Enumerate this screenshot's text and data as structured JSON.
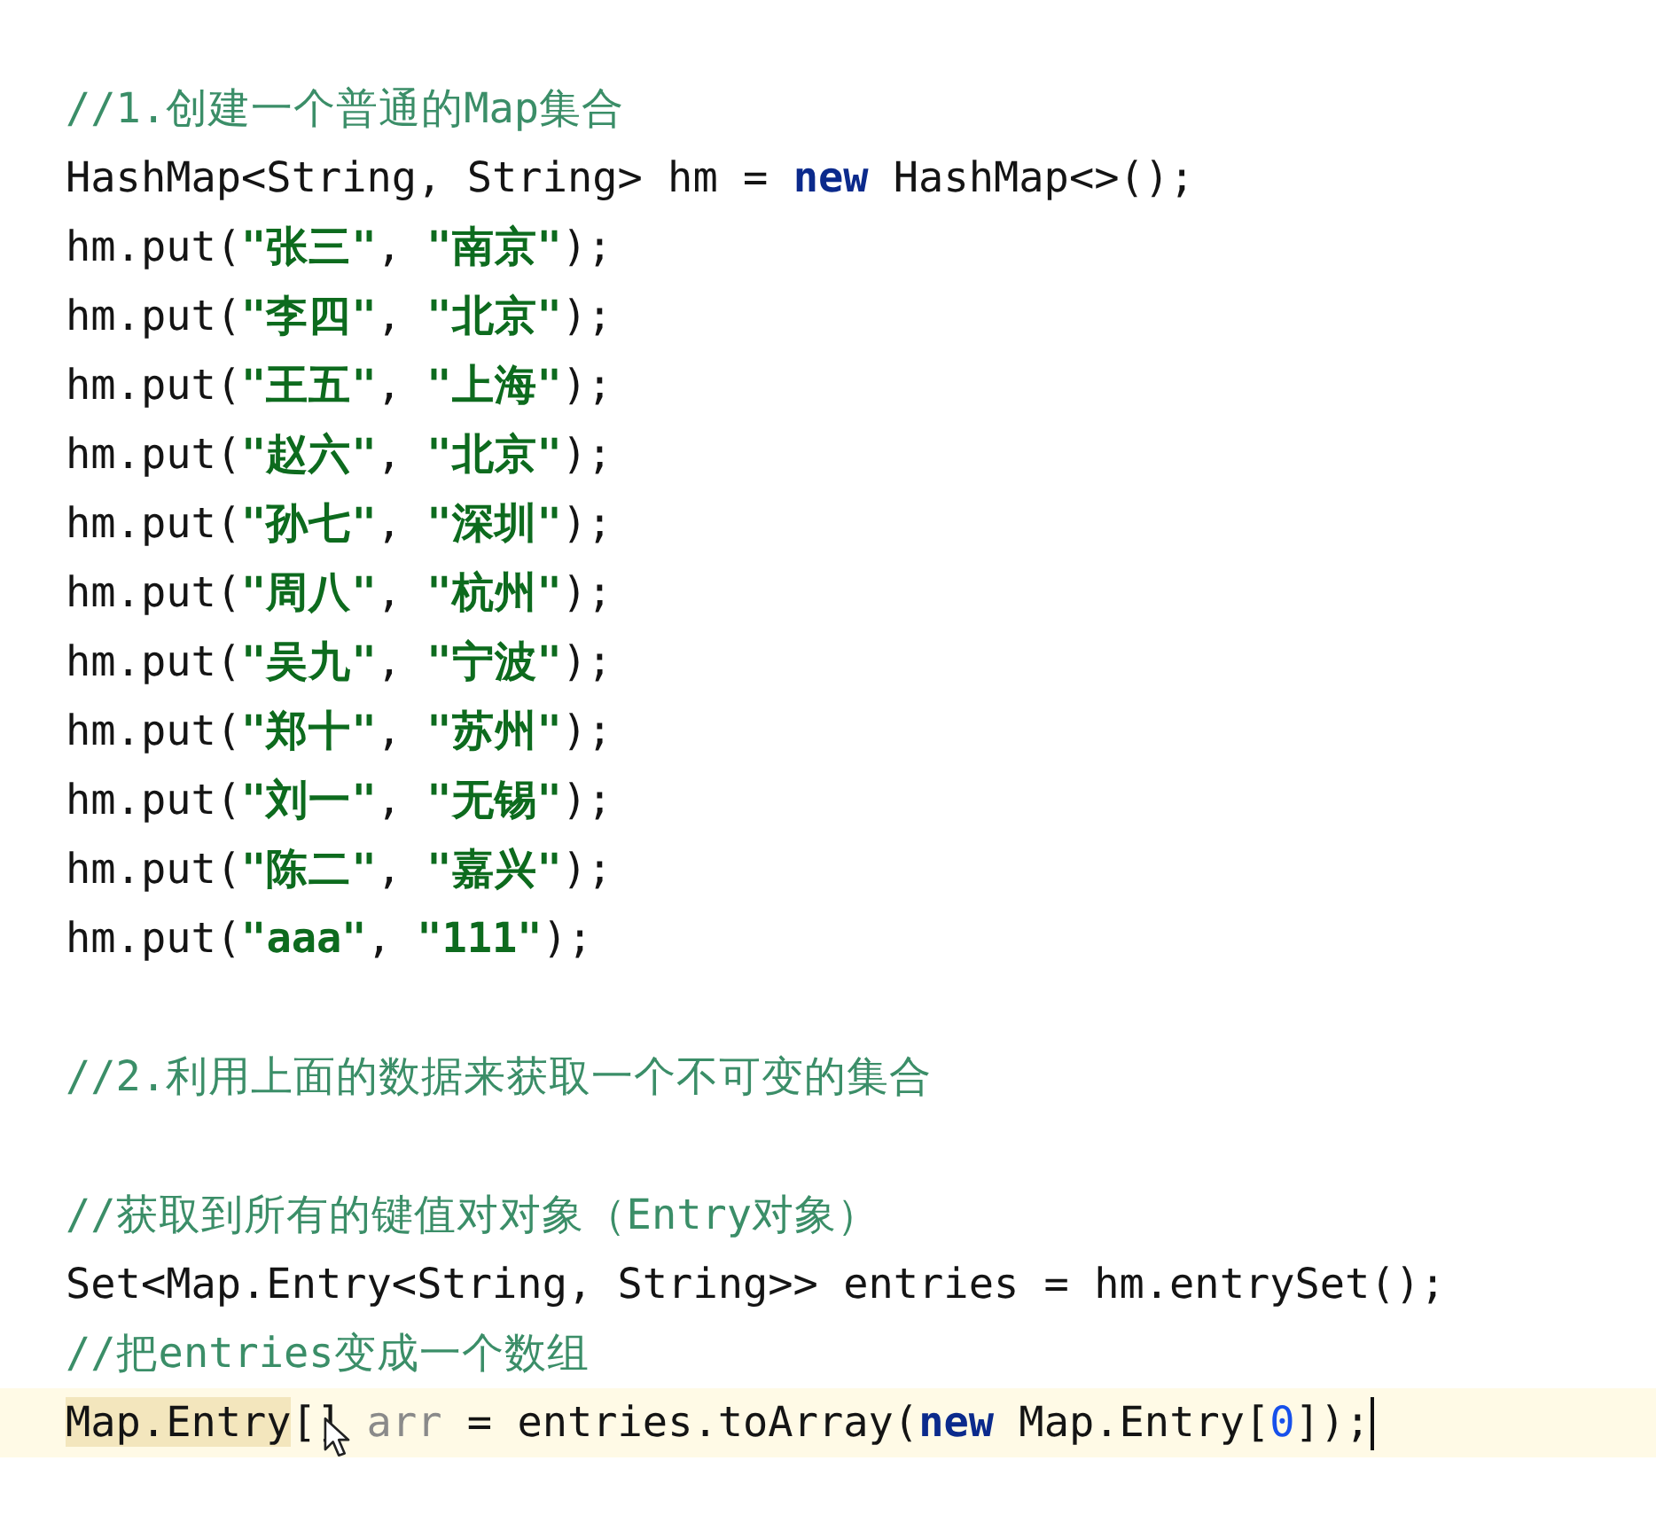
{
  "editor": {
    "lines": [
      {
        "current": false,
        "tokens": [
          {
            "kind": "comment",
            "text": "//1.创建一个普通的Map集合"
          }
        ]
      },
      {
        "current": false,
        "tokens": [
          {
            "kind": "plain",
            "text": "HashMap<String, String> hm = "
          },
          {
            "kind": "keyword",
            "text": "new"
          },
          {
            "kind": "plain",
            "text": " HashMap<>();"
          }
        ]
      },
      {
        "current": false,
        "tokens": [
          {
            "kind": "plain",
            "text": "hm.put("
          },
          {
            "kind": "string",
            "text": "\"张三\""
          },
          {
            "kind": "plain",
            "text": ", "
          },
          {
            "kind": "string",
            "text": "\"南京\""
          },
          {
            "kind": "plain",
            "text": ");"
          }
        ]
      },
      {
        "current": false,
        "tokens": [
          {
            "kind": "plain",
            "text": "hm.put("
          },
          {
            "kind": "string",
            "text": "\"李四\""
          },
          {
            "kind": "plain",
            "text": ", "
          },
          {
            "kind": "string",
            "text": "\"北京\""
          },
          {
            "kind": "plain",
            "text": ");"
          }
        ]
      },
      {
        "current": false,
        "tokens": [
          {
            "kind": "plain",
            "text": "hm.put("
          },
          {
            "kind": "string",
            "text": "\"王五\""
          },
          {
            "kind": "plain",
            "text": ", "
          },
          {
            "kind": "string",
            "text": "\"上海\""
          },
          {
            "kind": "plain",
            "text": ");"
          }
        ]
      },
      {
        "current": false,
        "tokens": [
          {
            "kind": "plain",
            "text": "hm.put("
          },
          {
            "kind": "string",
            "text": "\"赵六\""
          },
          {
            "kind": "plain",
            "text": ", "
          },
          {
            "kind": "string",
            "text": "\"北京\""
          },
          {
            "kind": "plain",
            "text": ");"
          }
        ]
      },
      {
        "current": false,
        "tokens": [
          {
            "kind": "plain",
            "text": "hm.put("
          },
          {
            "kind": "string",
            "text": "\"孙七\""
          },
          {
            "kind": "plain",
            "text": ", "
          },
          {
            "kind": "string",
            "text": "\"深圳\""
          },
          {
            "kind": "plain",
            "text": ");"
          }
        ]
      },
      {
        "current": false,
        "tokens": [
          {
            "kind": "plain",
            "text": "hm.put("
          },
          {
            "kind": "string",
            "text": "\"周八\""
          },
          {
            "kind": "plain",
            "text": ", "
          },
          {
            "kind": "string",
            "text": "\"杭州\""
          },
          {
            "kind": "plain",
            "text": ");"
          }
        ]
      },
      {
        "current": false,
        "tokens": [
          {
            "kind": "plain",
            "text": "hm.put("
          },
          {
            "kind": "string",
            "text": "\"吴九\""
          },
          {
            "kind": "plain",
            "text": ", "
          },
          {
            "kind": "string",
            "text": "\"宁波\""
          },
          {
            "kind": "plain",
            "text": ");"
          }
        ]
      },
      {
        "current": false,
        "tokens": [
          {
            "kind": "plain",
            "text": "hm.put("
          },
          {
            "kind": "string",
            "text": "\"郑十\""
          },
          {
            "kind": "plain",
            "text": ", "
          },
          {
            "kind": "string",
            "text": "\"苏州\""
          },
          {
            "kind": "plain",
            "text": ");"
          }
        ]
      },
      {
        "current": false,
        "tokens": [
          {
            "kind": "plain",
            "text": "hm.put("
          },
          {
            "kind": "string",
            "text": "\"刘一\""
          },
          {
            "kind": "plain",
            "text": ", "
          },
          {
            "kind": "string",
            "text": "\"无锡\""
          },
          {
            "kind": "plain",
            "text": ");"
          }
        ]
      },
      {
        "current": false,
        "tokens": [
          {
            "kind": "plain",
            "text": "hm.put("
          },
          {
            "kind": "string",
            "text": "\"陈二\""
          },
          {
            "kind": "plain",
            "text": ", "
          },
          {
            "kind": "string",
            "text": "\"嘉兴\""
          },
          {
            "kind": "plain",
            "text": ");"
          }
        ]
      },
      {
        "current": false,
        "tokens": [
          {
            "kind": "plain",
            "text": "hm.put("
          },
          {
            "kind": "string",
            "text": "\"aaa\""
          },
          {
            "kind": "plain",
            "text": ", "
          },
          {
            "kind": "string",
            "text": "\"111\""
          },
          {
            "kind": "plain",
            "text": ");"
          }
        ]
      },
      {
        "current": false
      },
      {
        "current": false,
        "tokens": [
          {
            "kind": "comment",
            "text": "//2.利用上面的数据来获取一个不可变的集合"
          }
        ]
      },
      {
        "current": false
      },
      {
        "current": false,
        "tokens": [
          {
            "kind": "comment",
            "text": "//获取到所有的键值对对象（Entry对象）"
          }
        ]
      },
      {
        "current": false,
        "tokens": [
          {
            "kind": "plain",
            "text": "Set<Map.Entry<String, String>> entries = hm.entrySet();"
          }
        ]
      },
      {
        "current": false,
        "tokens": [
          {
            "kind": "comment",
            "text": "//把entries变成一个数组"
          }
        ]
      },
      {
        "current": true,
        "tokens": [
          {
            "kind": "plain",
            "text": "Map.Entry",
            "highlighted": true
          },
          {
            "kind": "plain",
            "text": "[] ",
            "highlighted": false
          },
          {
            "kind": "unused",
            "text": "arr"
          },
          {
            "kind": "plain",
            "text": " = entries.toArray("
          },
          {
            "kind": "keyword",
            "text": "new"
          },
          {
            "kind": "plain",
            "text": " Map.Entry["
          },
          {
            "kind": "number",
            "text": "0"
          },
          {
            "kind": "plain",
            "text": "]);"
          }
        ]
      }
    ]
  }
}
